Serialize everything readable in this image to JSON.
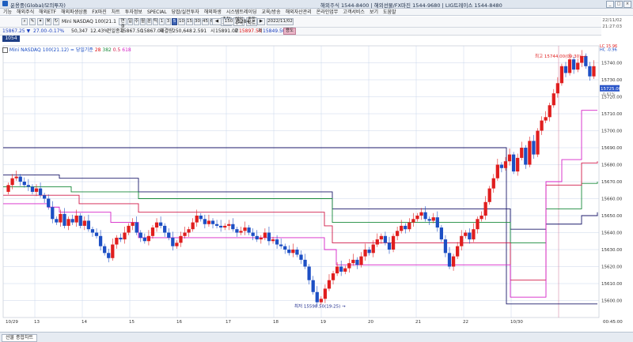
{
  "app": {
    "title": "운용중(Global/모의투자)",
    "hotlines": "해외주식 1544-8400 | 해외선물/FX마진 1544-9680 | LIG트레이스 1544-8480"
  },
  "menu": [
    "기능",
    "해외주식",
    "해외ETF",
    "해외파생상품",
    "FX마진",
    "차트",
    "투자정보",
    "SPECIAL",
    "당잡/실전투자",
    "해외파생",
    "시스템트레이딩",
    "교육/방송",
    "해외자산관리",
    "온라인업무",
    "고객서비스",
    "보기",
    "도움말"
  ],
  "clock": {
    "date": "22/11/02",
    "time": "21:27:03"
  },
  "toolbar": {
    "symbol": "1054",
    "mini_label": "Mini NASDAQ 100(21.1",
    "fields": [
      "연결",
      "일",
      "주",
      "월",
      "분",
      "틱",
      "1",
      "3",
      "5",
      "10",
      "15",
      "30",
      "45",
      "60"
    ],
    "active_period": "5",
    "mode_buttons": [
      "추천\n계좌",
      "해외\n주식",
      "종합\n차트"
    ],
    "count": "150",
    "count_total": "1284",
    "date": "2022/11/02"
  },
  "quote": {
    "price": "15867.25",
    "change": "▼",
    "chg_pts": "27.00",
    "chg_pct": "-0.17%",
    "volume": "50,347",
    "ratio": "12.43%",
    "prev_close_label": "전일종가",
    "prev_close": "15867.50",
    "last": "15867.00",
    "contract_label": "체결량",
    "contract": "250,648",
    "contract_ratio": "2.591",
    "open_label": "시",
    "open": "15891.00",
    "high_label": "고",
    "high": "15897.50",
    "low_label": "저",
    "low": "15849.50",
    "extra_btn": "용도"
  },
  "legend": {
    "text": "Mini NASDAQ 100(21.12) = 당일기준",
    "vals": [
      "28",
      "382",
      "0.5",
      "618"
    ]
  },
  "annotations": {
    "high_label": "최고 15744.00(09:30)",
    "low_label": "최저 15598.50(19:25)"
  },
  "price_tags": {
    "current": "15725.00",
    "lc": "LC 15.96",
    "hc": "HC -0.96",
    "pct": "-0.61%"
  },
  "status": {
    "tab": "선물 종합차트"
  },
  "chart_data": {
    "type": "candlestick",
    "y_axis": {
      "min": 15590,
      "max": 15750
    },
    "y_ticks": [
      15600,
      15610,
      15620,
      15630,
      15640,
      15650,
      15660,
      15670,
      15680,
      15690,
      15700,
      15710,
      15720,
      15730,
      15740
    ],
    "x_ticks": [
      "10/29",
      "13",
      "14",
      "15",
      "16",
      "17",
      "18",
      "19",
      "20",
      "21",
      "22",
      "10/30",
      "00:45:00"
    ],
    "colors": {
      "up": "#e01e1e",
      "down": "#1d4fc4",
      "navy": "#1c1a6b",
      "green": "#198a3b",
      "crimson": "#d01a4a",
      "magenta": "#d623c8"
    }
  }
}
